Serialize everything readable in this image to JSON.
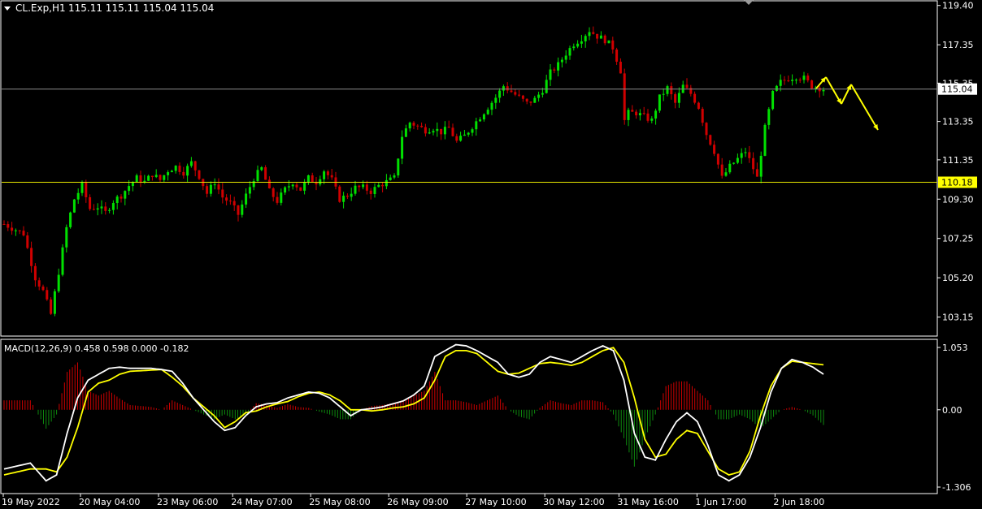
{
  "header": {
    "symbol": "CL.Exp,H1",
    "ohlc": "115.11 115.11 115.04 115.04"
  },
  "colors": {
    "background": "#000000",
    "bull": "#00e000",
    "bear": "#d00000",
    "level_line": "#e8e800",
    "price_line": "#8c8c8c",
    "macd_main": "#ffffff",
    "macd_signal": "#ffff00",
    "annotation": "#ffff00",
    "axis_text": "#ffffff",
    "price_badge_bg": "#ffffff",
    "level_badge_bg": "#ffff00"
  },
  "chart_data": [
    {
      "type": "candlestick",
      "name": "CL.Exp H1",
      "ylim": [
        102.2,
        119.6
      ],
      "y_ticks": [
        "119.40",
        "117.35",
        "115.35",
        "113.35",
        "111.35",
        "109.30",
        "107.25",
        "105.20",
        "103.15"
      ],
      "y_tick_values": [
        119.4,
        117.35,
        115.35,
        113.35,
        111.35,
        109.3,
        107.25,
        105.2,
        103.15
      ],
      "x_labels": [
        "19 May 2022",
        "20 May 04:00",
        "23 May 06:00",
        "24 May 07:00",
        "25 May 08:00",
        "26 May 09:00",
        "27 May 10:00",
        "30 May 12:00",
        "31 May 16:00",
        "1 Jun 17:00",
        "2 Jun 18:00"
      ],
      "current_price": 115.04,
      "current_price_label": "115.04",
      "level": 110.18,
      "level_label": "110.18",
      "close_path": [
        [
          0,
          108.0
        ],
        [
          5,
          107.5
        ],
        [
          8,
          105.2
        ],
        [
          10,
          104.5
        ],
        [
          12,
          103.3
        ],
        [
          14,
          105.5
        ],
        [
          16,
          107.8
        ],
        [
          18,
          109.3
        ],
        [
          20,
          110.0
        ],
        [
          22,
          108.8
        ],
        [
          24,
          108.9
        ],
        [
          26,
          108.6
        ],
        [
          28,
          109.2
        ],
        [
          30,
          109.5
        ],
        [
          32,
          110.0
        ],
        [
          34,
          110.4
        ],
        [
          36,
          110.2
        ],
        [
          38,
          110.6
        ],
        [
          40,
          110.3
        ],
        [
          42,
          110.8
        ],
        [
          44,
          111.0
        ],
        [
          46,
          110.7
        ],
        [
          48,
          111.2
        ],
        [
          50,
          110.5
        ],
        [
          52,
          109.6
        ],
        [
          54,
          110.2
        ],
        [
          56,
          109.4
        ],
        [
          58,
          109.1
        ],
        [
          60,
          108.5
        ],
        [
          62,
          109.5
        ],
        [
          64,
          110.4
        ],
        [
          66,
          110.9
        ],
        [
          68,
          109.7
        ],
        [
          70,
          109.2
        ],
        [
          72,
          109.8
        ],
        [
          74,
          110.2
        ],
        [
          76,
          109.8
        ],
        [
          78,
          110.4
        ],
        [
          80,
          110.2
        ],
        [
          82,
          110.8
        ],
        [
          84,
          110.3
        ],
        [
          86,
          109.3
        ],
        [
          88,
          109.5
        ],
        [
          90,
          109.9
        ],
        [
          92,
          109.9
        ],
        [
          94,
          109.7
        ],
        [
          96,
          110.0
        ],
        [
          98,
          110.2
        ],
        [
          100,
          110.4
        ],
        [
          102,
          112.6
        ],
        [
          104,
          113.3
        ],
        [
          106,
          113.1
        ],
        [
          108,
          112.9
        ],
        [
          110,
          113.0
        ],
        [
          112,
          112.8
        ],
        [
          114,
          113.0
        ],
        [
          116,
          112.3
        ],
        [
          118,
          112.6
        ],
        [
          120,
          113.1
        ],
        [
          122,
          113.6
        ],
        [
          124,
          114.1
        ],
        [
          126,
          114.6
        ],
        [
          128,
          115.2
        ],
        [
          130,
          114.9
        ],
        [
          132,
          114.6
        ],
        [
          134,
          114.3
        ],
        [
          136,
          114.5
        ],
        [
          138,
          115.0
        ],
        [
          140,
          115.9
        ],
        [
          142,
          116.3
        ],
        [
          144,
          116.9
        ],
        [
          146,
          117.4
        ],
        [
          148,
          117.7
        ],
        [
          150,
          118.1
        ],
        [
          152,
          117.8
        ],
        [
          154,
          117.6
        ],
        [
          156,
          117.2
        ],
        [
          158,
          116.0
        ],
        [
          159,
          113.4
        ],
        [
          160,
          113.8
        ],
        [
          162,
          113.8
        ],
        [
          164,
          113.6
        ],
        [
          166,
          113.4
        ],
        [
          168,
          114.6
        ],
        [
          170,
          115.1
        ],
        [
          172,
          114.3
        ],
        [
          174,
          115.2
        ],
        [
          176,
          114.8
        ],
        [
          178,
          114.1
        ],
        [
          180,
          112.7
        ],
        [
          182,
          111.8
        ],
        [
          184,
          110.4
        ],
        [
          186,
          111.0
        ],
        [
          188,
          111.4
        ],
        [
          190,
          111.8
        ],
        [
          192,
          110.9
        ],
        [
          193,
          110.4
        ],
        [
          195,
          113.0
        ],
        [
          197,
          114.8
        ],
        [
          199,
          115.4
        ],
        [
          201,
          115.6
        ],
        [
          203,
          115.7
        ],
        [
          205,
          115.6
        ],
        [
          207,
          115.2
        ],
        [
          209,
          115.1
        ],
        [
          210,
          115.04
        ]
      ],
      "annotation_arrows": [
        [
          [
            1004,
            109
          ],
          [
            1016,
            95
          ]
        ],
        [
          [
            1016,
            95
          ],
          [
            1035,
            128
          ]
        ],
        [
          [
            1035,
            128
          ],
          [
            1047,
            104
          ]
        ],
        [
          [
            1047,
            104
          ],
          [
            1080,
            160
          ]
        ]
      ]
    },
    {
      "type": "macd",
      "label": "MACD(12,26,9) 0.458 0.598 0.000 -0.182",
      "ylim": [
        -1.306,
        1.053
      ],
      "y_ticks": [
        "1.053",
        "0.00",
        "-1.306"
      ],
      "y_tick_values": [
        1.053,
        0.0,
        -1.306
      ],
      "main_path": [
        [
          0,
          -1.0
        ],
        [
          5,
          -0.9
        ],
        [
          8,
          -1.2
        ],
        [
          10,
          -1.1
        ],
        [
          12,
          -0.4
        ],
        [
          14,
          0.2
        ],
        [
          16,
          0.5
        ],
        [
          18,
          0.6
        ],
        [
          20,
          0.7
        ],
        [
          22,
          0.72
        ],
        [
          24,
          0.7
        ],
        [
          26,
          0.7
        ],
        [
          28,
          0.7
        ],
        [
          30,
          0.68
        ],
        [
          32,
          0.65
        ],
        [
          34,
          0.45
        ],
        [
          36,
          0.2
        ],
        [
          38,
          0.0
        ],
        [
          40,
          -0.2
        ],
        [
          42,
          -0.35
        ],
        [
          44,
          -0.3
        ],
        [
          46,
          -0.1
        ],
        [
          48,
          0.05
        ],
        [
          50,
          0.1
        ],
        [
          52,
          0.12
        ],
        [
          54,
          0.2
        ],
        [
          56,
          0.25
        ],
        [
          58,
          0.3
        ],
        [
          60,
          0.28
        ],
        [
          62,
          0.2
        ],
        [
          64,
          0.05
        ],
        [
          66,
          -0.1
        ],
        [
          68,
          0.0
        ],
        [
          70,
          0.02
        ],
        [
          72,
          0.05
        ],
        [
          74,
          0.1
        ],
        [
          76,
          0.15
        ],
        [
          78,
          0.25
        ],
        [
          80,
          0.4
        ],
        [
          82,
          0.9
        ],
        [
          84,
          1.0
        ],
        [
          86,
          1.1
        ],
        [
          88,
          1.08
        ],
        [
          90,
          1.0
        ],
        [
          92,
          0.9
        ],
        [
          94,
          0.8
        ],
        [
          96,
          0.6
        ],
        [
          98,
          0.55
        ],
        [
          100,
          0.6
        ],
        [
          102,
          0.8
        ],
        [
          104,
          0.9
        ],
        [
          106,
          0.85
        ],
        [
          108,
          0.8
        ],
        [
          110,
          0.9
        ],
        [
          112,
          1.0
        ],
        [
          114,
          1.08
        ],
        [
          116,
          1.0
        ],
        [
          118,
          0.5
        ],
        [
          120,
          -0.4
        ],
        [
          122,
          -0.8
        ],
        [
          124,
          -0.85
        ],
        [
          126,
          -0.5
        ],
        [
          128,
          -0.2
        ],
        [
          130,
          -0.05
        ],
        [
          132,
          -0.2
        ],
        [
          134,
          -0.6
        ],
        [
          136,
          -1.1
        ],
        [
          138,
          -1.2
        ],
        [
          140,
          -1.1
        ],
        [
          142,
          -0.8
        ],
        [
          144,
          -0.3
        ],
        [
          146,
          0.3
        ],
        [
          148,
          0.7
        ],
        [
          150,
          0.85
        ],
        [
          152,
          0.8
        ],
        [
          154,
          0.72
        ],
        [
          156,
          0.6
        ]
      ],
      "signal_path": [
        [
          0,
          -1.1
        ],
        [
          5,
          -1.0
        ],
        [
          8,
          -1.0
        ],
        [
          10,
          -1.05
        ],
        [
          12,
          -0.8
        ],
        [
          14,
          -0.3
        ],
        [
          16,
          0.3
        ],
        [
          18,
          0.45
        ],
        [
          20,
          0.5
        ],
        [
          22,
          0.6
        ],
        [
          24,
          0.65
        ],
        [
          26,
          0.66
        ],
        [
          28,
          0.67
        ],
        [
          30,
          0.68
        ],
        [
          32,
          0.55
        ],
        [
          34,
          0.4
        ],
        [
          36,
          0.2
        ],
        [
          38,
          0.05
        ],
        [
          40,
          -0.1
        ],
        [
          42,
          -0.3
        ],
        [
          44,
          -0.2
        ],
        [
          46,
          -0.05
        ],
        [
          48,
          -0.02
        ],
        [
          50,
          0.05
        ],
        [
          52,
          0.1
        ],
        [
          54,
          0.14
        ],
        [
          56,
          0.22
        ],
        [
          58,
          0.28
        ],
        [
          60,
          0.3
        ],
        [
          62,
          0.25
        ],
        [
          64,
          0.15
        ],
        [
          66,
          0.0
        ],
        [
          68,
          0.0
        ],
        [
          70,
          -0.02
        ],
        [
          72,
          0.0
        ],
        [
          74,
          0.03
        ],
        [
          76,
          0.05
        ],
        [
          78,
          0.1
        ],
        [
          80,
          0.2
        ],
        [
          82,
          0.5
        ],
        [
          84,
          0.9
        ],
        [
          86,
          1.0
        ],
        [
          88,
          1.0
        ],
        [
          90,
          0.95
        ],
        [
          92,
          0.8
        ],
        [
          94,
          0.65
        ],
        [
          96,
          0.6
        ],
        [
          98,
          0.62
        ],
        [
          100,
          0.7
        ],
        [
          102,
          0.78
        ],
        [
          104,
          0.8
        ],
        [
          106,
          0.78
        ],
        [
          108,
          0.75
        ],
        [
          110,
          0.8
        ],
        [
          112,
          0.9
        ],
        [
          114,
          1.0
        ],
        [
          116,
          1.05
        ],
        [
          118,
          0.8
        ],
        [
          120,
          0.2
        ],
        [
          122,
          -0.5
        ],
        [
          124,
          -0.8
        ],
        [
          126,
          -0.75
        ],
        [
          128,
          -0.5
        ],
        [
          130,
          -0.35
        ],
        [
          132,
          -0.4
        ],
        [
          134,
          -0.7
        ],
        [
          136,
          -1.0
        ],
        [
          138,
          -1.1
        ],
        [
          140,
          -1.05
        ],
        [
          142,
          -0.7
        ],
        [
          144,
          -0.1
        ],
        [
          146,
          0.4
        ],
        [
          148,
          0.7
        ],
        [
          150,
          0.82
        ],
        [
          152,
          0.8
        ],
        [
          154,
          0.78
        ],
        [
          156,
          0.76
        ]
      ]
    }
  ]
}
